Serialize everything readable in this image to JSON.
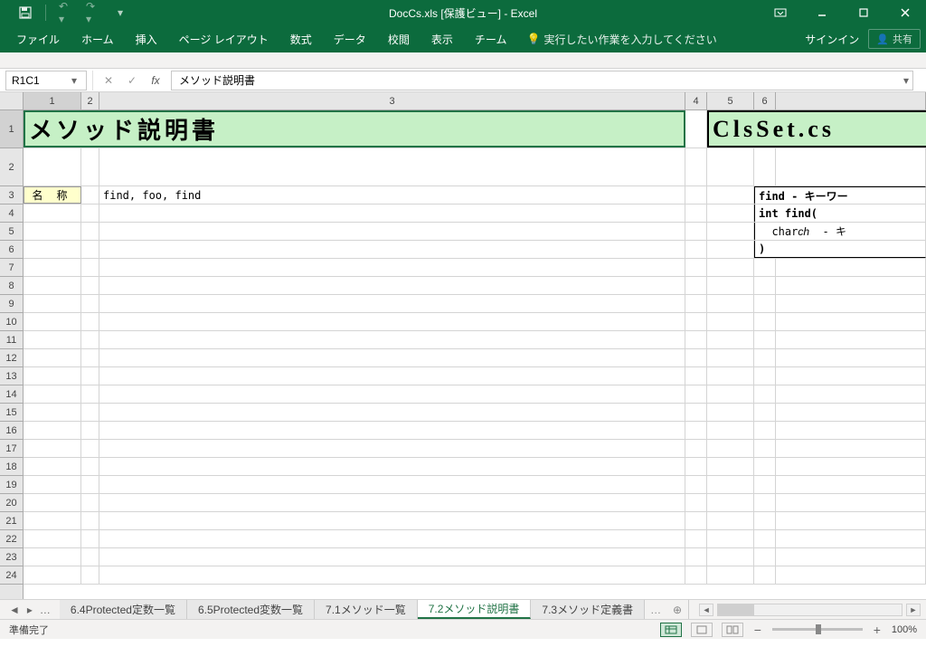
{
  "title": "DocCs.xls [保護ビュー] - Excel",
  "qat": {
    "save": "💾",
    "undo": "↶",
    "redo": "↷"
  },
  "ribbon": {
    "file": "ファイル",
    "tabs": [
      "ホーム",
      "挿入",
      "ページ レイアウト",
      "数式",
      "データ",
      "校閲",
      "表示",
      "チーム"
    ],
    "tellme": "実行したい作業を入力してください",
    "signin": "サインイン",
    "share": "共有"
  },
  "namebox": "R1C1",
  "formula": "メソッド説明書",
  "colHeaders": [
    "1",
    "2",
    "3",
    "4",
    "5",
    "6"
  ],
  "rowHeaders": [
    "1",
    "2",
    "3",
    "4",
    "5",
    "6",
    "7",
    "8",
    "9",
    "10",
    "11",
    "12",
    "13",
    "14",
    "15",
    "16",
    "17",
    "18",
    "19",
    "20",
    "21",
    "22",
    "23",
    "24"
  ],
  "cells": {
    "title": "メソッド説明書",
    "filename": "ClsSet.cs",
    "nameLabel": "名 称",
    "nameValue": "find, foo, find",
    "sig1": "find - キーワー",
    "sig2": "int find(",
    "sig3": "  char ch  - キ",
    "sig4": ")"
  },
  "sheetTabs": [
    "6.4Protected定数一覧",
    "6.5Protected変数一覧",
    "7.1メソッド一覧",
    "7.2メソッド説明書",
    "7.3メソッド定義書"
  ],
  "activeTab": 3,
  "status": "準備完了",
  "zoom": "100%"
}
